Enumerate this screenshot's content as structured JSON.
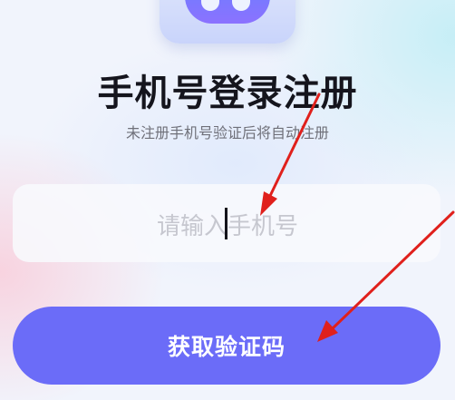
{
  "header": {
    "logo_icon": "app-logo-icon",
    "title": "手机号登录注册",
    "subtitle": "未注册手机号验证后将自动注册"
  },
  "form": {
    "phone_placeholder": "请输入手机号",
    "phone_value": "",
    "submit_label": "获取验证码"
  },
  "colors": {
    "accent": "#6b6cf8",
    "annotation_arrow": "#e0201c",
    "title": "#15151d",
    "subtitle": "#6f7079",
    "placeholder": "#c6c7cf"
  },
  "annotations": [
    {
      "icon": "red-arrow-icon",
      "target": "phone-input"
    },
    {
      "icon": "red-arrow-icon",
      "target": "get-code-button"
    }
  ]
}
